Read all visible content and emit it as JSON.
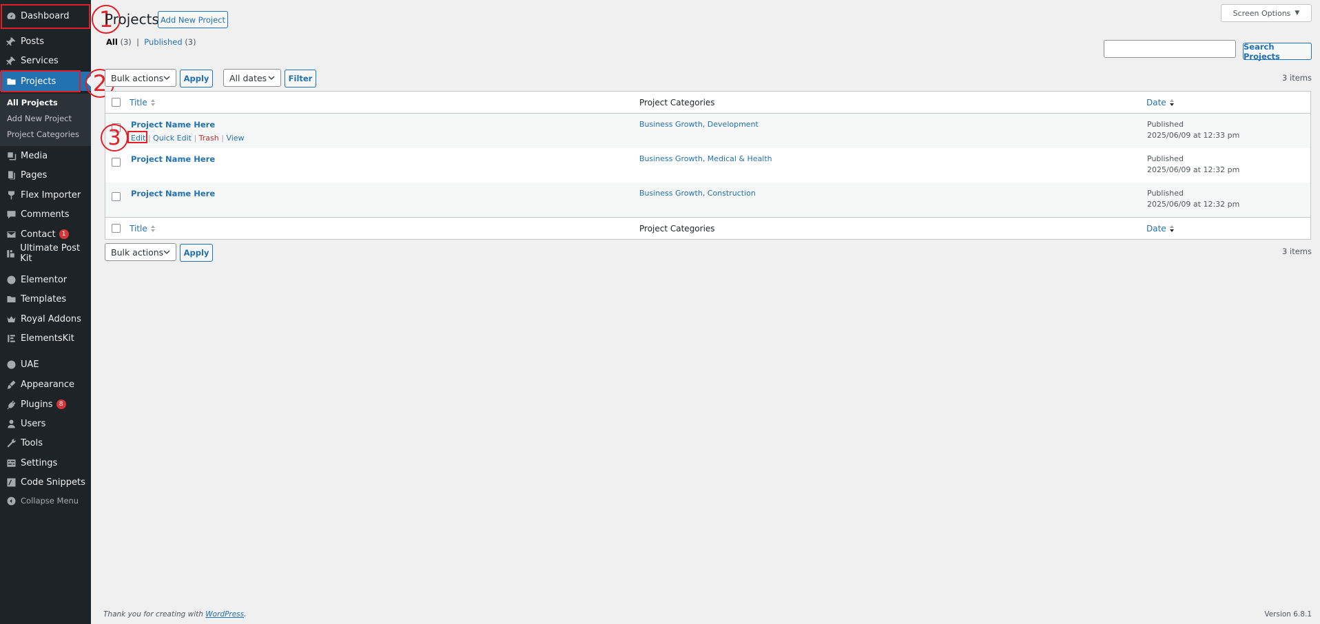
{
  "sidebar": {
    "items": [
      {
        "label": "Dashboard",
        "icon": "dashboard-icon"
      },
      {
        "label": "Posts",
        "icon": "pin-icon"
      },
      {
        "label": "Services",
        "icon": "pin-icon"
      },
      {
        "label": "Projects",
        "icon": "folder-icon"
      },
      {
        "label": "Media",
        "icon": "media-icon"
      },
      {
        "label": "Pages",
        "icon": "pages-icon"
      },
      {
        "label": "Flex Importer",
        "icon": "flex-importer-icon"
      },
      {
        "label": "Comments",
        "icon": "comment-icon"
      },
      {
        "label": "Contact",
        "icon": "mail-icon",
        "badge": "1"
      },
      {
        "label": "Ultimate Post Kit",
        "icon": "post-kit-icon"
      },
      {
        "label": "Elementor",
        "icon": "elementor-icon"
      },
      {
        "label": "Templates",
        "icon": "folder-icon"
      },
      {
        "label": "Royal Addons",
        "icon": "crown-icon"
      },
      {
        "label": "ElementsKit",
        "icon": "elementskit-icon"
      },
      {
        "label": "UAE",
        "icon": "uae-icon"
      },
      {
        "label": "Appearance",
        "icon": "brush-icon"
      },
      {
        "label": "Plugins",
        "icon": "plugin-icon",
        "badge": "8"
      },
      {
        "label": "Users",
        "icon": "user-icon"
      },
      {
        "label": "Tools",
        "icon": "wrench-icon"
      },
      {
        "label": "Settings",
        "icon": "settings-icon"
      },
      {
        "label": "Code Snippets",
        "icon": "code-icon"
      }
    ],
    "submenu": [
      "All Projects",
      "Add New Project",
      "Project Categories"
    ],
    "collapse_label": "Collapse Menu"
  },
  "annotations": [
    "1",
    "2",
    "3"
  ],
  "header": {
    "title": "Projects",
    "add_new": "Add New Project",
    "screen_options": "Screen Options"
  },
  "filters": {
    "all_label": "All",
    "all_count": "(3)",
    "separator": "|",
    "published_label": "Published",
    "published_count": "(3)"
  },
  "search": {
    "button": "Search Projects",
    "value": ""
  },
  "tablenav": {
    "bulk_actions": "Bulk actions",
    "apply": "Apply",
    "all_dates": "All dates",
    "filter": "Filter",
    "items_count": "3 items"
  },
  "table": {
    "columns": [
      "Title",
      "Project Categories",
      "Date"
    ],
    "rows": [
      {
        "title": "Project Name Here",
        "categories": "Business Growth, Development",
        "status": "Published",
        "date": "2025/06/09 at 12:33 pm"
      },
      {
        "title": "Project Name Here",
        "categories": "Business Growth, Medical & Health",
        "status": "Published",
        "date": "2025/06/09 at 12:32 pm"
      },
      {
        "title": "Project Name Here",
        "categories": "Business Growth, Construction",
        "status": "Published",
        "date": "2025/06/09 at 12:32 pm"
      }
    ],
    "row_actions": {
      "edit": "Edit",
      "quick_edit": "Quick Edit",
      "trash": "Trash",
      "view": "View",
      "sep": "|"
    }
  },
  "footer": {
    "thanks_prefix": "Thank you for creating with ",
    "wordpress_link": "WordPress",
    "thanks_suffix": ".",
    "version": "Version 6.8.1"
  },
  "colors": {
    "sidebar_bg": "#1d2327",
    "accent": "#2271b1",
    "annotation": "#e21e26",
    "badge": "#d63638",
    "trash": "#b32d2e"
  }
}
